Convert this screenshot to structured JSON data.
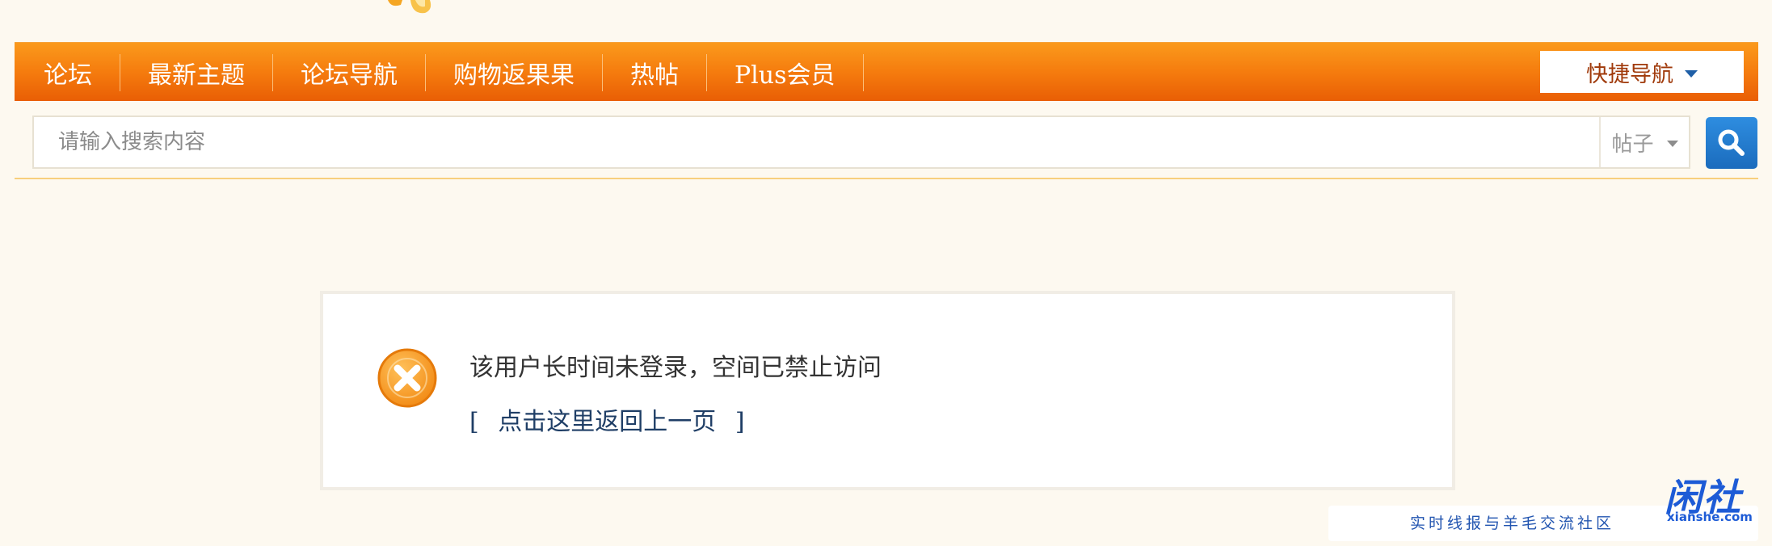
{
  "nav": {
    "items": [
      {
        "label": "论坛"
      },
      {
        "label": "最新主题"
      },
      {
        "label": "论坛导航"
      },
      {
        "label": "购物返果果"
      },
      {
        "label": "热帖"
      },
      {
        "label": "Plus会员"
      }
    ],
    "quick_nav_label": "快捷导航"
  },
  "search": {
    "placeholder": "请输入搜索内容",
    "type_label": "帖子"
  },
  "message": {
    "text": "该用户长时间未登录，空间已禁止访问",
    "back_open": "[",
    "back_label": "点击这里返回上一页",
    "back_close": "]"
  },
  "watermark": {
    "logo_text": "闲社",
    "domain": "xianshe.com",
    "tagline": "实时线报与羊毛交流社区"
  },
  "colors": {
    "nav_orange": "#f57c0e",
    "search_blue": "#1b6cbd",
    "error_orange": "#f7941d"
  },
  "icons": {
    "search_button": "magnifier-icon",
    "error": "close-circle-icon",
    "dropdown": "caret-down-icon"
  }
}
